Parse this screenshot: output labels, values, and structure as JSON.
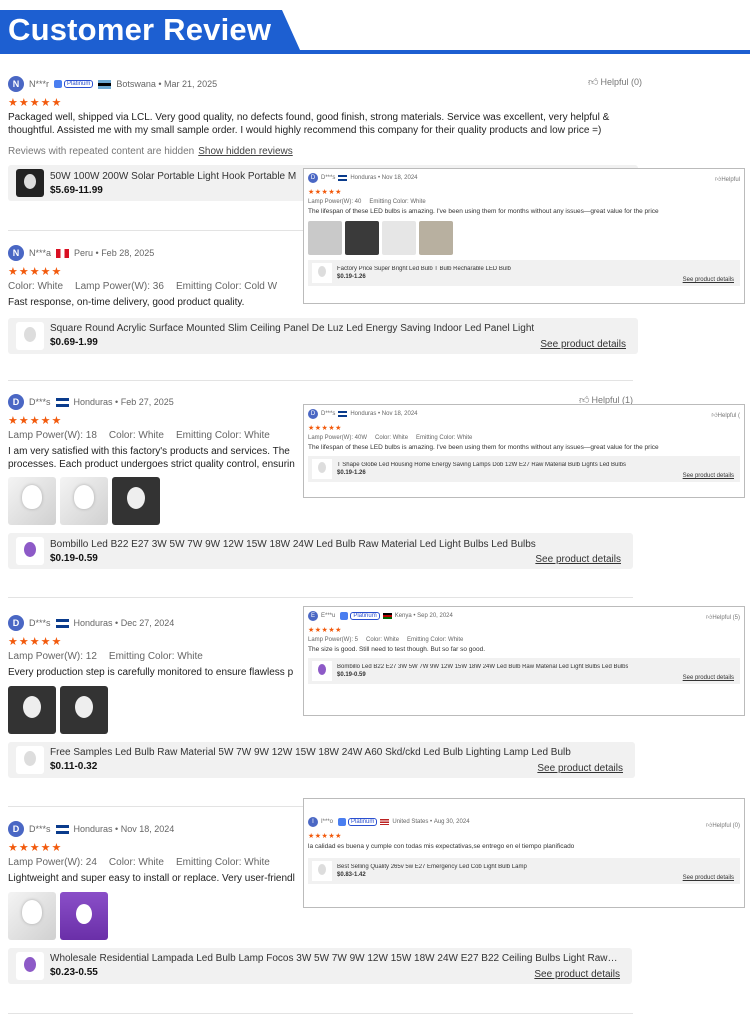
{
  "header": {
    "title": "Customer Review",
    "accent": "#1d5fd1"
  },
  "reviews": [
    {
      "initial": "N",
      "name": "N***r",
      "country": "Botswana",
      "date": "Mar 21, 2025",
      "platinum": "Platinum",
      "helpful": "Helpful (0)",
      "text": "Packaged well, shipped via LCL. Very good quality, no defects found, good finish, strong materials. Service  was excellent, very helpful & thoughtful. Assisted me with my small sample order. I would highly recommend this company for their quality products and low price =)",
      "hidden_text": "Reviews with repeated content are hidden",
      "hidden_link": "Show hidden reviews",
      "product": {
        "name": "50W 100W 200W Solar Portable Light Hook Portable M",
        "price": "$5.69-11.99"
      }
    },
    {
      "initial": "N",
      "name": "N***a",
      "country": "Peru",
      "date": "Feb 28, 2025",
      "attrs": [
        "Color:  White",
        "Lamp Power(W):  36",
        "Emitting Color:  Cold W"
      ],
      "text": "Fast response, on-time delivery, good product quality.",
      "product": {
        "name": "Square Round Acrylic Surface Mounted Slim Ceiling Panel De Luz Led Energy Saving Indoor Led Panel Light",
        "price": "$0.69-1.99",
        "details": "See product details"
      }
    },
    {
      "initial": "D",
      "name": "D***s",
      "country": "Honduras",
      "date": "Feb 27, 2025",
      "helpful": "Helpful (1)",
      "attrs": [
        "Lamp Power(W):  18",
        "Color:  White",
        "Emitting Color:  White"
      ],
      "text": "I am very satisfied with this factory's products and services. The processes. Each product undergoes strict quality control, ensurin",
      "product": {
        "name": "Bombillo Led B22 E27 3W 5W 7W 9W 12W 15W 18W 24W Led Bulb Raw Material Led Light Bulbs Led Bulbs",
        "price": "$0.19-0.59",
        "details": "See product details"
      }
    },
    {
      "initial": "D",
      "name": "D***s",
      "country": "Honduras",
      "date": "Dec 27, 2024",
      "attrs": [
        "Lamp Power(W):  12",
        "Emitting Color:  White"
      ],
      "text": "Every production step is carefully monitored to ensure flawless p",
      "product": {
        "name": "Free Samples Led Bulb Raw Material 5W 7W 9W 12W 15W 18W 24W A60 Skd/ckd Led Bulb Lighting Lamp Led Bulb",
        "price": "$0.11-0.32",
        "details": "See product details"
      }
    },
    {
      "initial": "D",
      "name": "D***s",
      "country": "Honduras",
      "date": "Nov 18, 2024",
      "attrs": [
        "Lamp Power(W):  24",
        "Color:  White",
        "Emitting Color:  White"
      ],
      "text": "Lightweight and super easy to install or replace. Very user-friendl",
      "product": {
        "name": "Wholesale Residential Lampada Led Bulb Lamp Focos 3W 5W 7W 9W 12W 15W 18W 24W E27 B22 Ceiling Bulbs Light Raw M...",
        "price": "$0.23-0.55",
        "details": "See product details"
      }
    }
  ],
  "overlays": [
    {
      "initial": "D",
      "name": "D***s",
      "country": "Honduras",
      "date": "Nov 18, 2024",
      "helpful": "Helpful",
      "attrs": [
        "Lamp Power(W):  40",
        "Emitting Color:  White"
      ],
      "text": "The lifespan of these LED bulbs is amazing. I've been using them for months without any issues—great value for the price",
      "product": {
        "name": "Factory Price Super Bright Led Bulb T Bulb Recharable LED Bulb",
        "price": "$0.19-1.26",
        "details": "See product details"
      }
    },
    {
      "initial": "D",
      "name": "D***s",
      "country": "Honduras",
      "date": "Nov 18, 2024",
      "helpful": "Helpful (",
      "attrs": [
        "Lamp Power(W):  40W",
        "Color:  White",
        "Emitting Color:  White"
      ],
      "text": "The lifespan of these LED bulbs is amazing. I've been using them for months without any issues—great value for the price",
      "product": {
        "name": "T Shape Globe Led Housing Home Energy Saving Lamps Dob 12W E27 Raw Material Bulb Lights Led Bulbs",
        "price": "$0.19-1.26",
        "details": "See product details"
      }
    },
    {
      "initial": "E",
      "name": "E***u",
      "country": "Kenya",
      "date": "Sep 20, 2024",
      "platinum": "Platinum",
      "helpful": "Helpful (5)",
      "attrs": [
        "Lamp Power(W):  5",
        "Color:  White",
        "Emitting Color:  White"
      ],
      "text": "The size is good. Still need to test though. But so far so good.",
      "product": {
        "name": "Bombillo Led B22 E27 3W 5W 7W 9W 12W 15W 18W 24W Led Bulb Raw Material Led Light Bulbs Led Bulbs",
        "price": "$0.19-0.59",
        "details": "See product details"
      }
    },
    {
      "initial": "I",
      "name": "I***o",
      "country": "United States",
      "date": "Aug 30, 2024",
      "platinum": "Platinum",
      "helpful": "Helpful (0)",
      "text": "la calidad es buena y cumple con todas mis expectativas,se entrego en el tiempo planificado",
      "product": {
        "name": "Best Selling Quality 265v 5w E27 Emergency Led Cob Light Bulb Lamp",
        "price": "$0.83-1.42",
        "details": "See product details"
      }
    }
  ],
  "stars": "★★★★★",
  "icons": {
    "thumb": "thumbs-up-icon",
    "verified": "platinum-badge-icon"
  }
}
